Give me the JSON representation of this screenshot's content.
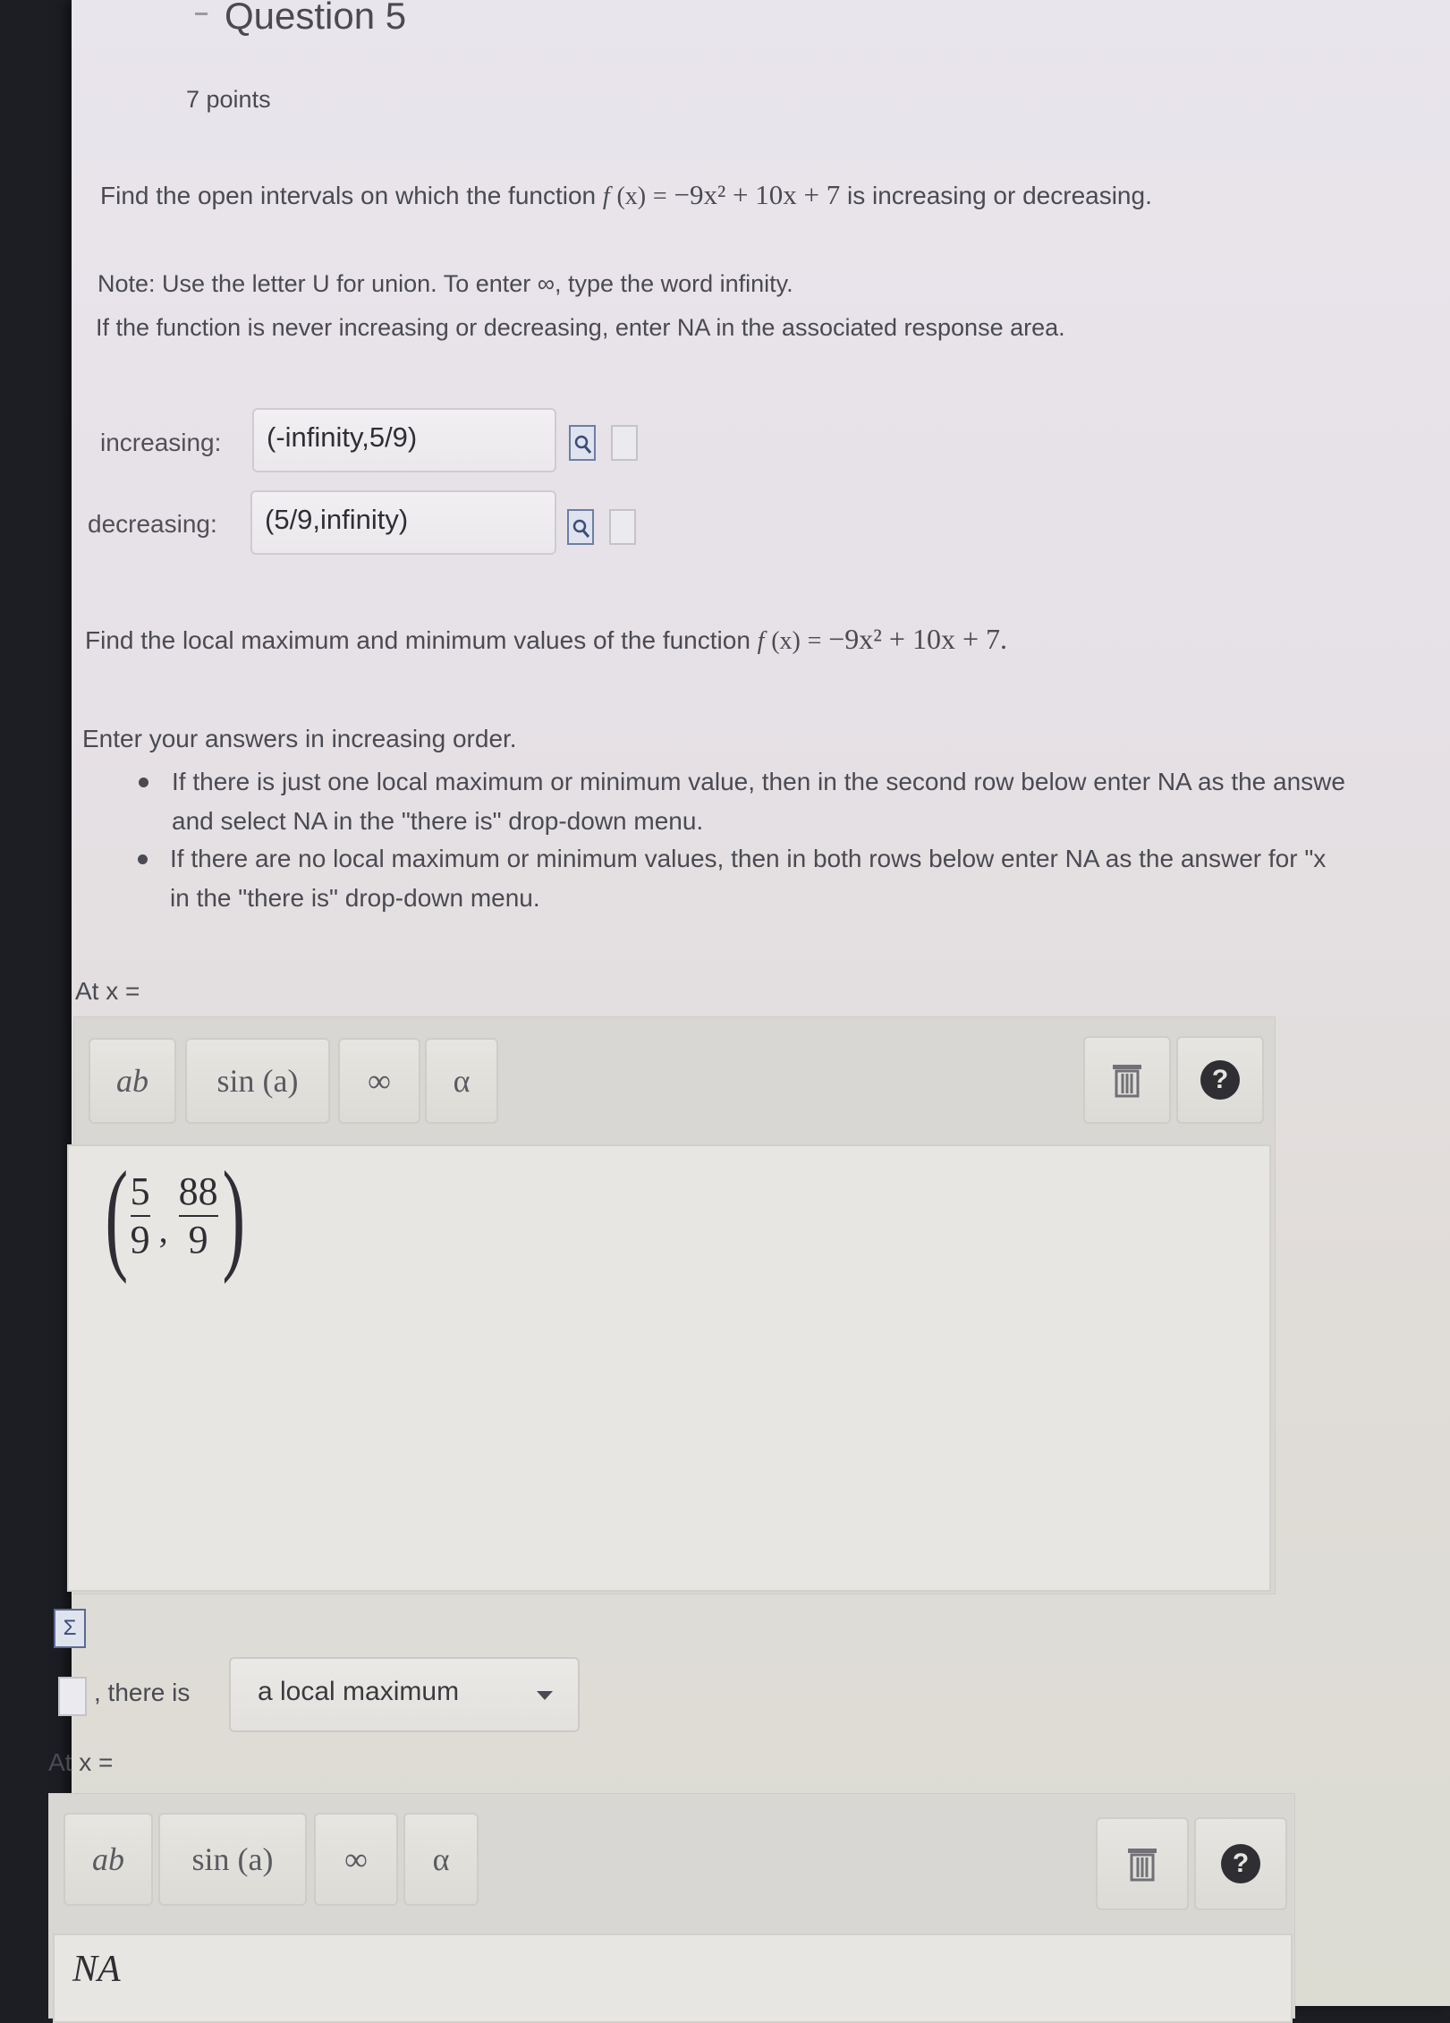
{
  "question": {
    "title": "Question 5",
    "points": "7 points"
  },
  "prompt1": {
    "before": "Find the open intervals on which the function ",
    "func_name": "f",
    "func_arg": "(x)",
    "equals": "=",
    "expr": "−9x² + 10x + 7",
    "after": " is increasing or decreasing."
  },
  "note": {
    "line1": "Note: Use the letter U for union. To enter ∞, type the word infinity.",
    "line2": "If the function is never increasing or decreasing, enter NA in the associated response area."
  },
  "answers": {
    "increasing_label": "increasing:",
    "increasing_value": "(-infinity,5/9)",
    "decreasing_label": "decreasing:",
    "decreasing_value": "(5/9,infinity)"
  },
  "prompt2": {
    "before": "Find the local maximum and minimum values of the function ",
    "func_name": "f",
    "func_arg": "(x)",
    "equals": "=",
    "expr": "−9x² + 10x + 7."
  },
  "instructions": {
    "intro": "Enter your answers in increasing order.",
    "bullet1_line1": "If there is just one local maximum or minimum value, then in the second row below enter NA as the answe",
    "bullet1_line2": "and select NA in the \"there is\" drop-down menu.",
    "bullet2_line1": "If there are no local maximum or minimum values, then in both rows below enter NA as the answer for \"x",
    "bullet2_line2": "in the \"there is\" drop-down menu."
  },
  "row1": {
    "at_label": "At x =",
    "toolbar": {
      "power": "ab",
      "sin": "sin (a)",
      "infinity": "∞",
      "alpha": "α"
    },
    "answer": {
      "num1": "5",
      "den1": "9",
      "num2": "88",
      "den2": "9"
    },
    "there_is_label": ", there is",
    "dropdown_value": "a local maximum"
  },
  "row2": {
    "at_label": "At x =",
    "toolbar": {
      "power": "ab",
      "sin": "sin (a)",
      "infinity": "∞",
      "alpha": "α"
    },
    "answer_text": "NA"
  },
  "icons": [
    "preview-icon",
    "file-icon",
    "trash-icon",
    "help-icon",
    "sigma-icon",
    "chevron-down-icon"
  ]
}
